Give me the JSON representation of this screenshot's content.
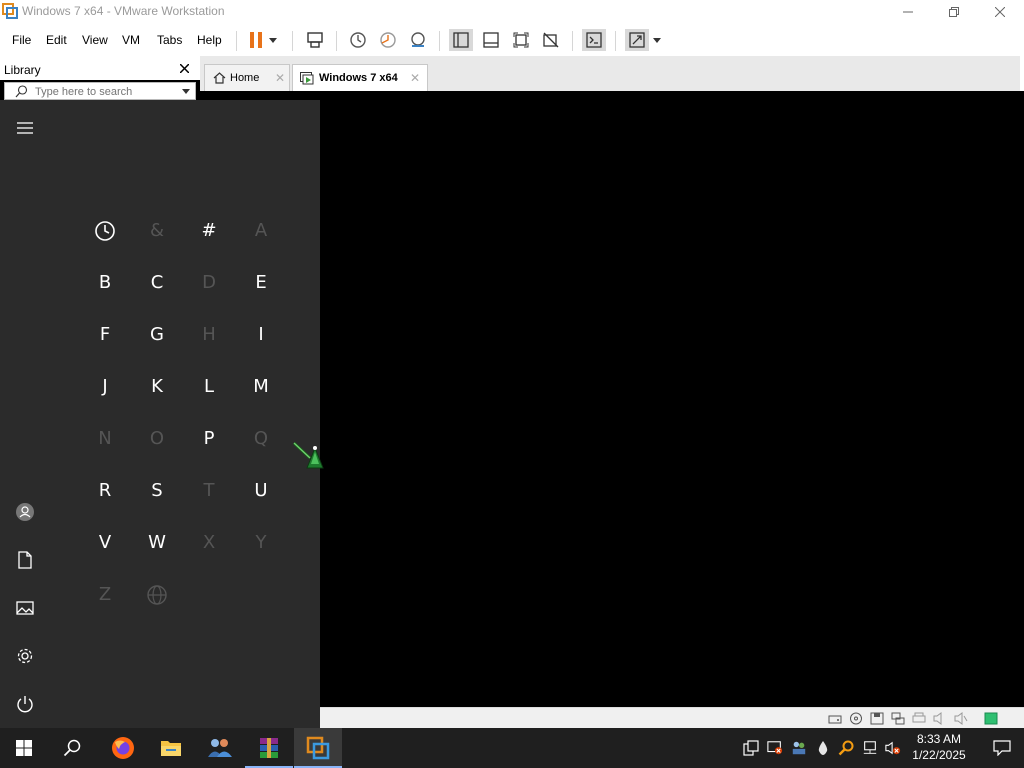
{
  "window": {
    "title": "Windows 7 x64 - VMware Workstation"
  },
  "menubar": {
    "items": [
      {
        "label": "File"
      },
      {
        "label": "Edit"
      },
      {
        "label": "View"
      },
      {
        "label": "VM"
      },
      {
        "label": "Tabs"
      },
      {
        "label": "Help"
      }
    ]
  },
  "library": {
    "title": "Library",
    "search_placeholder": "Type here to search"
  },
  "tabs": [
    {
      "label": "Home",
      "icon": "home-icon",
      "active": false
    },
    {
      "label": "Windows 7 x64",
      "icon": "vm-icon",
      "active": true
    }
  ],
  "startmenu": {
    "letters": [
      {
        "char": "clock",
        "enabled": true
      },
      {
        "char": "&",
        "enabled": false
      },
      {
        "char": "#",
        "enabled": true
      },
      {
        "char": "A",
        "enabled": false
      },
      {
        "char": "B",
        "enabled": true
      },
      {
        "char": "C",
        "enabled": true
      },
      {
        "char": "D",
        "enabled": false
      },
      {
        "char": "E",
        "enabled": true
      },
      {
        "char": "F",
        "enabled": true
      },
      {
        "char": "G",
        "enabled": true
      },
      {
        "char": "H",
        "enabled": false
      },
      {
        "char": "I",
        "enabled": true
      },
      {
        "char": "J",
        "enabled": true
      },
      {
        "char": "K",
        "enabled": true
      },
      {
        "char": "L",
        "enabled": true
      },
      {
        "char": "M",
        "enabled": true
      },
      {
        "char": "N",
        "enabled": false
      },
      {
        "char": "O",
        "enabled": false
      },
      {
        "char": "P",
        "enabled": true
      },
      {
        "char": "Q",
        "enabled": false
      },
      {
        "char": "R",
        "enabled": true
      },
      {
        "char": "S",
        "enabled": true
      },
      {
        "char": "T",
        "enabled": false
      },
      {
        "char": "U",
        "enabled": true
      },
      {
        "char": "V",
        "enabled": true
      },
      {
        "char": "W",
        "enabled": true
      },
      {
        "char": "X",
        "enabled": false
      },
      {
        "char": "Y",
        "enabled": false
      },
      {
        "char": "Z",
        "enabled": false
      },
      {
        "char": "globe",
        "enabled": false
      }
    ],
    "rail": [
      "hamburger-icon",
      "user-icon",
      "documents-icon",
      "pictures-icon",
      "settings-icon",
      "power-icon"
    ]
  },
  "taskbar": {
    "apps": [
      "firefox-icon",
      "file-explorer-icon",
      "people-app-icon",
      "winrar-icon",
      "vmware-icon"
    ],
    "clock_time": "8:33 AM",
    "clock_date": "1/22/2025"
  },
  "colors": {
    "accent_orange": "#e8731a",
    "startmenu_bg": "#2b2b2b",
    "taskbar_bg": "#1f1f1f"
  }
}
